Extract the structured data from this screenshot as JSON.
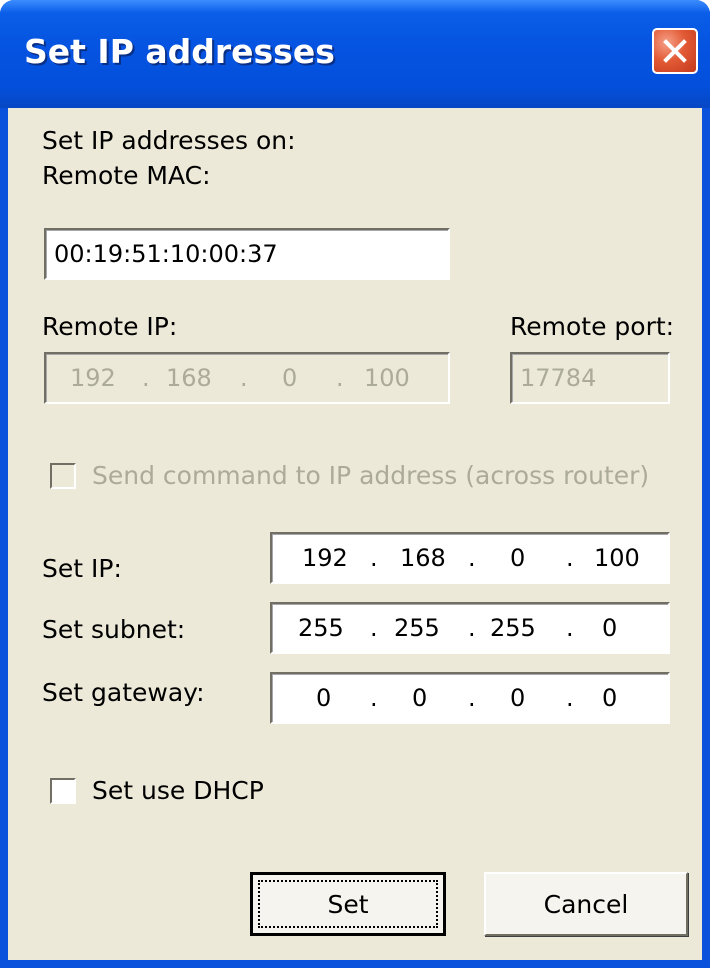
{
  "window": {
    "title": "Set IP addresses"
  },
  "header": {
    "intro": "Set IP addresses on:"
  },
  "remote_mac": {
    "label": "Remote MAC:",
    "value": "00:19:51:10:00:37"
  },
  "remote_ip": {
    "label": "Remote IP:",
    "octets": [
      "192",
      "168",
      "0",
      "100"
    ],
    "separator": "."
  },
  "remote_port": {
    "label": "Remote port:",
    "value": "17784"
  },
  "send_command": {
    "label": "Send command to IP address (across router)",
    "checked": false,
    "enabled": false
  },
  "set_ip": {
    "label": "Set IP:",
    "octets": [
      "192",
      "168",
      "0",
      "100"
    ]
  },
  "set_subnet": {
    "label": "Set subnet:",
    "octets": [
      "255",
      "255",
      "255",
      "0"
    ]
  },
  "set_gateway": {
    "label": "Set gateway:",
    "octets": [
      "0",
      "0",
      "0",
      "0"
    ]
  },
  "use_dhcp": {
    "label": "Set use DHCP",
    "checked": false
  },
  "buttons": {
    "set": "Set",
    "cancel": "Cancel"
  },
  "colors": {
    "titlebar": "#0553e0",
    "dialog_bg": "#ece9d8",
    "disabled_text": "#acaa99",
    "close_button": "#e25a35"
  },
  "icons": {
    "close": "close-icon"
  }
}
